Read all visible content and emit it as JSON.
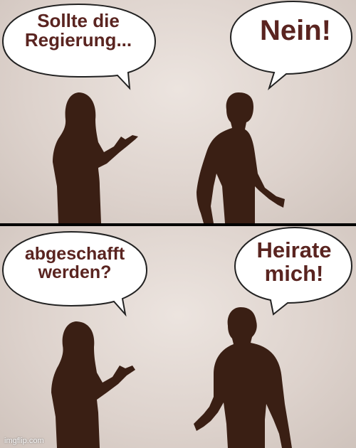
{
  "panels": [
    {
      "left_text": "Sollte die Regierung...",
      "right_text": "Nein!"
    },
    {
      "left_text": "abgeschafft werden?",
      "right_text": "Heirate mich!"
    }
  ],
  "watermark": "imgflip.com",
  "colors": {
    "text": "#5a2420",
    "silhouette": "#3a1f14",
    "background": "#e6ddd8",
    "divider": "#000000"
  }
}
